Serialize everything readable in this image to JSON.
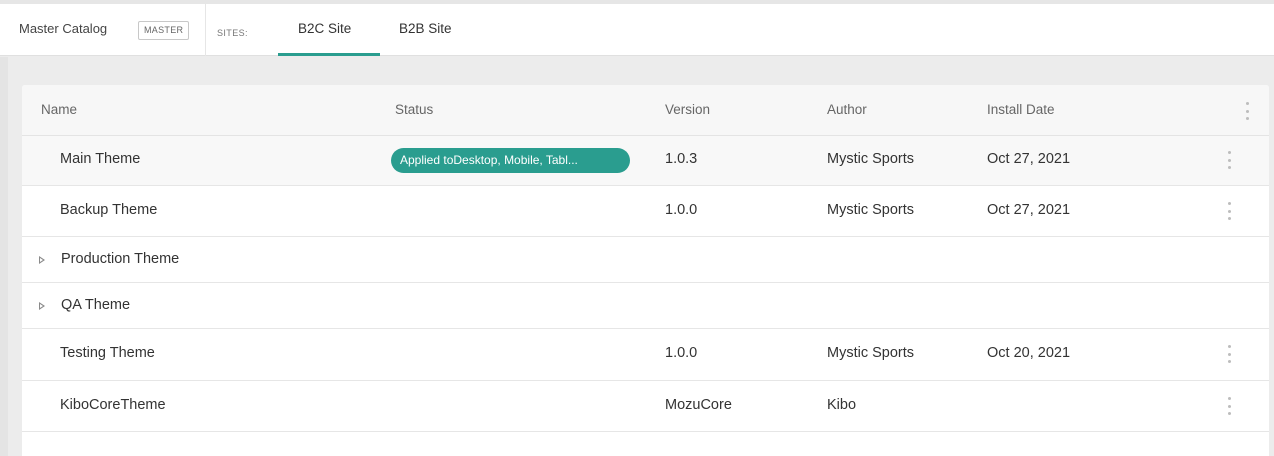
{
  "header": {
    "catalog_label": "Master Catalog",
    "catalog_badge": "MASTER",
    "sites_label": "SITES:",
    "tabs": [
      {
        "label": "B2C Site",
        "active": true
      },
      {
        "label": "B2B Site",
        "active": false
      }
    ]
  },
  "table": {
    "columns": [
      "Name",
      "Status",
      "Version",
      "Author",
      "Install Date"
    ],
    "rows": [
      {
        "name": "Main Theme",
        "status": "Applied toDesktop, Mobile, Tabl...",
        "version": "1.0.3",
        "author": "Mystic Sports",
        "date": "Oct 27, 2021",
        "expandable": false,
        "menu": true
      },
      {
        "name": "Backup Theme",
        "status": "",
        "version": "1.0.0",
        "author": "Mystic Sports",
        "date": "Oct 27, 2021",
        "expandable": false,
        "menu": true
      },
      {
        "name": "Production Theme",
        "status": "",
        "version": "",
        "author": "",
        "date": "",
        "expandable": true,
        "menu": false
      },
      {
        "name": "QA Theme",
        "status": "",
        "version": "",
        "author": "",
        "date": "",
        "expandable": true,
        "menu": false
      },
      {
        "name": "Testing Theme",
        "status": "",
        "version": "1.0.0",
        "author": "Mystic Sports",
        "date": "Oct 20, 2021",
        "expandable": false,
        "menu": true
      },
      {
        "name": "KiboCoreTheme",
        "status": "",
        "version": "MozuCore",
        "author": "Kibo",
        "date": "",
        "expandable": false,
        "menu": true
      }
    ]
  },
  "colors": {
    "accent": "#2a9d8f",
    "background": "#ececec",
    "header_row": "#f7f7f7"
  },
  "icons": {
    "row_menu": "more-vert-icon",
    "expander": "triangle-right-outline-icon"
  }
}
